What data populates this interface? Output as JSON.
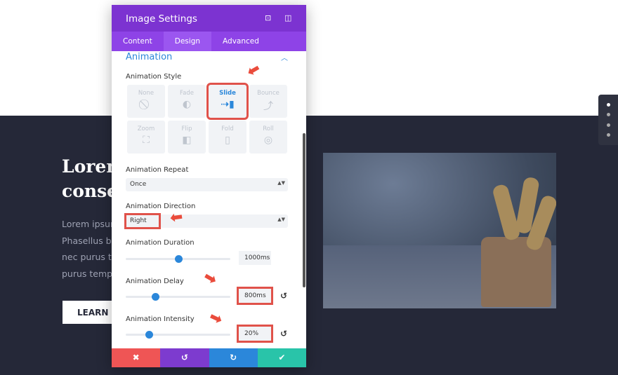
{
  "page": {
    "heading": "Lorem\nconsec",
    "body": "Lorem ipsum\nPhasellus bil\nnec purus te\npurus tempu",
    "button": "LEARN M"
  },
  "panel": {
    "title": "Image Settings",
    "icons": [
      "fullscreen-icon",
      "sidebar-icon"
    ],
    "tabs": [
      {
        "label": "Content"
      },
      {
        "label": "Design",
        "active": true
      },
      {
        "label": "Advanced"
      }
    ],
    "section": "Animation",
    "style_label": "Animation Style",
    "styles": [
      {
        "label": "None",
        "icon": "⃠"
      },
      {
        "label": "Fade",
        "icon": "◐"
      },
      {
        "label": "Slide",
        "icon": "⇢▮",
        "selected": true
      },
      {
        "label": "Bounce",
        "icon": "⤴"
      },
      {
        "label": "Zoom",
        "icon": "⛶"
      },
      {
        "label": "Flip",
        "icon": "◧"
      },
      {
        "label": "Fold",
        "icon": "▯"
      },
      {
        "label": "Roll",
        "icon": "◎"
      }
    ],
    "repeat_label": "Animation Repeat",
    "repeat_value": "Once",
    "direction_label": "Animation Direction",
    "direction_value": "Right",
    "duration_label": "Animation Duration",
    "duration_value": "1000ms",
    "duration_slider": 0.5,
    "delay_label": "Animation Delay",
    "delay_value": "800ms",
    "delay_slider": 0.28,
    "intensity_label": "Animation Intensity",
    "intensity_value": "20%",
    "intensity_slider": 0.22,
    "footer": [
      {
        "icon": "close-icon",
        "glyph": "✖",
        "color": "#ef5555"
      },
      {
        "icon": "undo-icon",
        "glyph": "↺",
        "color": "#7d3bcf"
      },
      {
        "icon": "redo-icon",
        "glyph": "↻",
        "color": "#2b87da"
      },
      {
        "icon": "check-icon",
        "glyph": "✔",
        "color": "#29c4a9"
      }
    ]
  },
  "colors": {
    "header": "#7c33d1",
    "accent": "#2b87da",
    "highlight": "#e0524a",
    "band": "#252838"
  }
}
